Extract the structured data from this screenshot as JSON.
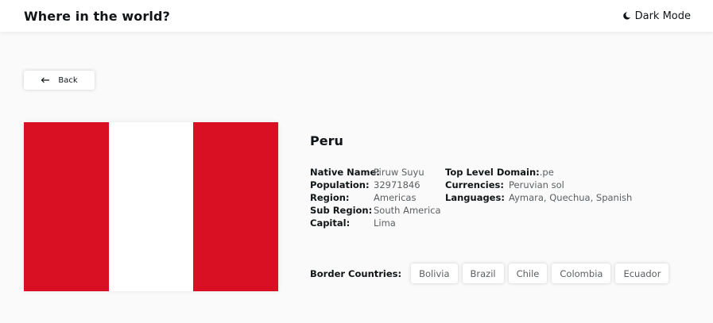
{
  "header": {
    "title": "Where in the world?",
    "dark_mode_label": "Dark Mode"
  },
  "back_button": {
    "label": "Back"
  },
  "flag": {
    "colors": [
      "#d91023",
      "#ffffff",
      "#d91023"
    ]
  },
  "country": {
    "name": "Peru",
    "details_left": [
      {
        "label": "Native Name:",
        "value": "Piruw Suyu"
      },
      {
        "label": "Population:",
        "value": "32971846"
      },
      {
        "label": "Region:",
        "value": "Americas"
      },
      {
        "label": "Sub Region:",
        "value": "South America"
      },
      {
        "label": "Capital:",
        "value": "Lima"
      }
    ],
    "details_right": [
      {
        "label": "Top Level Domain:",
        "value": ".pe"
      },
      {
        "label": "Currencies:",
        "value": "Peruvian sol"
      },
      {
        "label": "Languages:",
        "value": "Aymara, Quechua, Spanish"
      }
    ],
    "border_label": "Border Countries:",
    "borders": [
      "Bolivia",
      "Brazil",
      "Chile",
      "Colombia",
      "Ecuador"
    ]
  }
}
